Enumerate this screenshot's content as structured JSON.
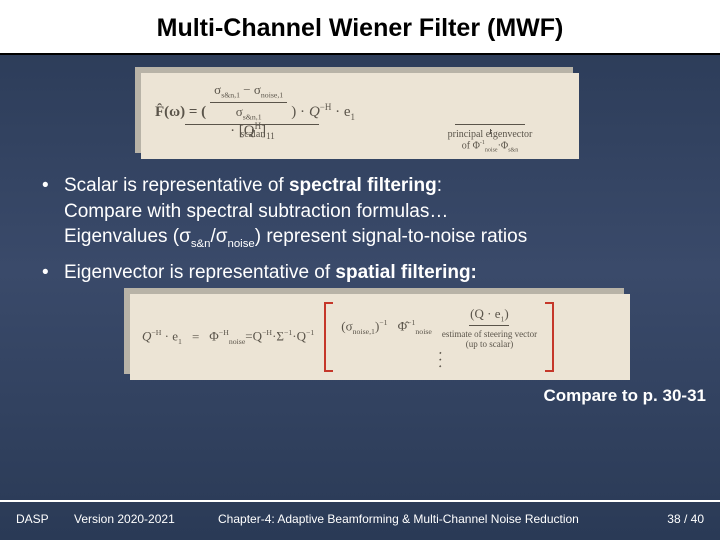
{
  "title": "Multi-Channel Wiener Filter (MWF)",
  "eq1": {
    "lhs": "F̂(ω) = (",
    "num": "σ",
    "num_sub": "s&n,1",
    "num_minus": " − σ",
    "num_sub2": "noise,1",
    "den": "σ",
    "den_sub": "s&n,1",
    "scalar": "scalar",
    "mid": " · [Q",
    "midH": "H",
    "mid2": "]",
    "mid2sub": "11",
    "mid3": ") ·  ",
    "rhs": "Q",
    "rhsH": "−H",
    "rhs2": " · e",
    "rhs2sub": "1",
    "rlbl1": "principal eigenvector",
    "rlbl2": "of Φ",
    "rlbl2a": "noise",
    "rlbl2b": "·Φ",
    "rlbl2c": "s&n"
  },
  "bullets": {
    "b1a": "Scalar is representative of ",
    "b1b": "spectral filtering",
    "b1c": ":",
    "b1d": "Compare with spectral subtraction formulas…",
    "b1e": "Eigenvalues (σ",
    "b1f": "s&n",
    "b1g": "/σ",
    "b1h": "noise",
    "b1i": ") represent signal-to-noise ratios",
    "b2a": "Eigenvector is representative of ",
    "b2b": "spatial filtering:"
  },
  "eq2": {
    "lhs": "Q",
    "lhsH": "−H",
    "lhsDot": " · e",
    "lhsSub": "1",
    "eq": " = ",
    "phi": "Φ",
    "phiSup": "−H",
    "phiSub": "noise",
    "mid": "=Q",
    "midH": "−H",
    "midSig": "·Σ",
    "midSigH": "−1",
    "midQ": "·Q",
    "midQH": "−1",
    "m11": "(σ",
    "m11sub": "noise,1",
    "m11end": ")",
    "m11sup": "−1",
    "m22": "Φ̂",
    "m22sup": "−1",
    "m22sub": "noise",
    "dots": "⋱",
    "col2a": "(Q · e",
    "col2asub": "1",
    "col2aend": ")",
    "steer1": "estimate of steering vector",
    "steer2": "(up to scalar)"
  },
  "compare": "Compare to p. 30-31",
  "footer": {
    "dasp": "DASP",
    "ver": "Version 2020-2021",
    "chap": "Chapter-4: Adaptive Beamforming & Multi-Channel Noise Reduction",
    "page": "38 / 40"
  }
}
